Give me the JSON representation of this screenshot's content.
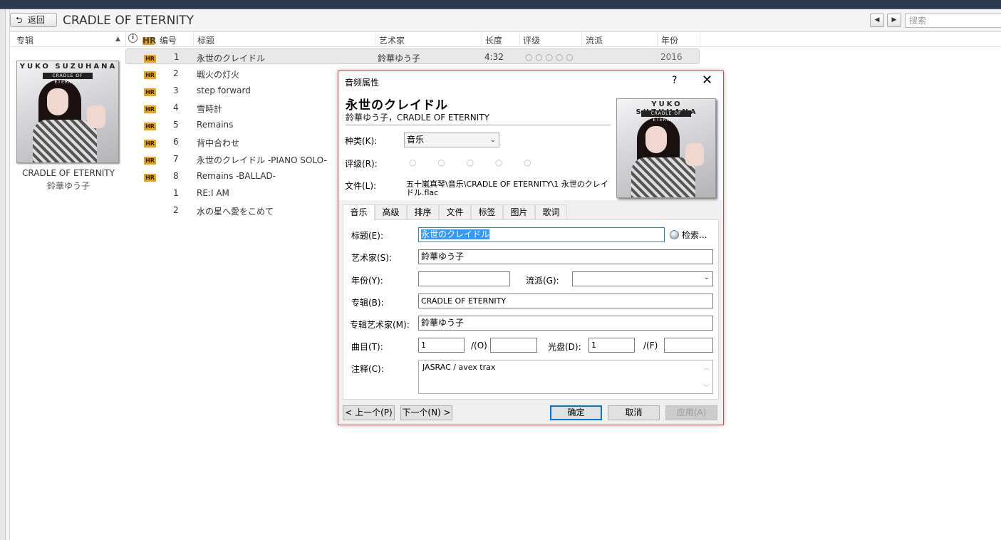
{
  "toolbar": {
    "back_label": "返回",
    "album_title": "CRADLE OF ETERNITY",
    "search_placeholder": "搜索"
  },
  "columns": {
    "album": "专辑",
    "number": "编号",
    "title": "标题",
    "artist": "艺术家",
    "length": "长度",
    "rating": "评级",
    "genre": "流派",
    "year": "年份"
  },
  "album": {
    "cover_title": "YUKO SUZUHANA",
    "cover_subtitle": "CRADLE OF ETERNITY",
    "name": "CRADLE OF ETERNITY",
    "artist": "鈴華ゆう子"
  },
  "tracks": [
    {
      "hr": "HR",
      "num": "1",
      "title": "永世のクレイドル",
      "artist": "鈴華ゆう子",
      "length": "4:32",
      "rating": "○ ○ ○ ○ ○",
      "year": "2016"
    },
    {
      "hr": "HR",
      "num": "2",
      "title": "戦火の灯火"
    },
    {
      "hr": "HR",
      "num": "3",
      "title": "step forward"
    },
    {
      "hr": "HR",
      "num": "4",
      "title": "雪時計"
    },
    {
      "hr": "HR",
      "num": "5",
      "title": "Remains"
    },
    {
      "hr": "HR",
      "num": "6",
      "title": "背中合わせ"
    },
    {
      "hr": "HR",
      "num": "7",
      "title": "永世のクレイドル -PIANO SOLO-"
    },
    {
      "hr": "HR",
      "num": "8",
      "title": "Remains -BALLAD-"
    },
    {
      "hr": "",
      "num": "1",
      "title": "RE:I AM"
    },
    {
      "hr": "",
      "num": "2",
      "title": "水の星へ愛をこめて"
    }
  ],
  "dialog": {
    "title": "音频属性",
    "help": "?",
    "close": "✕",
    "song_title": "永世のクレイドル",
    "song_sub": "鈴華ゆう子，CRADLE OF ETERNITY",
    "type_label": "种类(K):",
    "type_value": "音乐",
    "rating_label": "评级(R):",
    "rating_value": "○ ○ ○ ○ ○",
    "file_label": "文件(L):",
    "file_path": "五十嵐真琴\\音乐\\CRADLE OF ETERNITY\\1 永世のクレイドル.flac",
    "tabs": [
      "音乐",
      "高级",
      "排序",
      "文件",
      "标签",
      "图片",
      "歌词"
    ],
    "fields": {
      "title_label": "标题(E):",
      "title_value": "永世のクレイドル",
      "search_label": "检索...",
      "artist_label": "艺术家(S):",
      "artist_value": "鈴華ゆう子",
      "year_label": "年份(Y):",
      "year_value": "",
      "genre_label": "流派(G):",
      "genre_value": "",
      "album_label": "专辑(B):",
      "album_value": "CRADLE OF ETERNITY",
      "album_artist_label": "专辑艺术家(M):",
      "album_artist_value": "鈴華ゆう子",
      "track_label": "曲目(T):",
      "track_value": "1",
      "track_of_label": "/(O)",
      "track_of_value": "",
      "disc_label": "光盘(D):",
      "disc_value": "1",
      "disc_of_label": "/(F)",
      "disc_of_value": "",
      "comment_label": "注释(C):",
      "comment_value": "JASRAC / avex trax"
    },
    "buttons": {
      "prev": "< 上一个(P)",
      "next": "下一个(N) >",
      "ok": "确定",
      "cancel": "取消",
      "apply": "应用(A)"
    }
  }
}
